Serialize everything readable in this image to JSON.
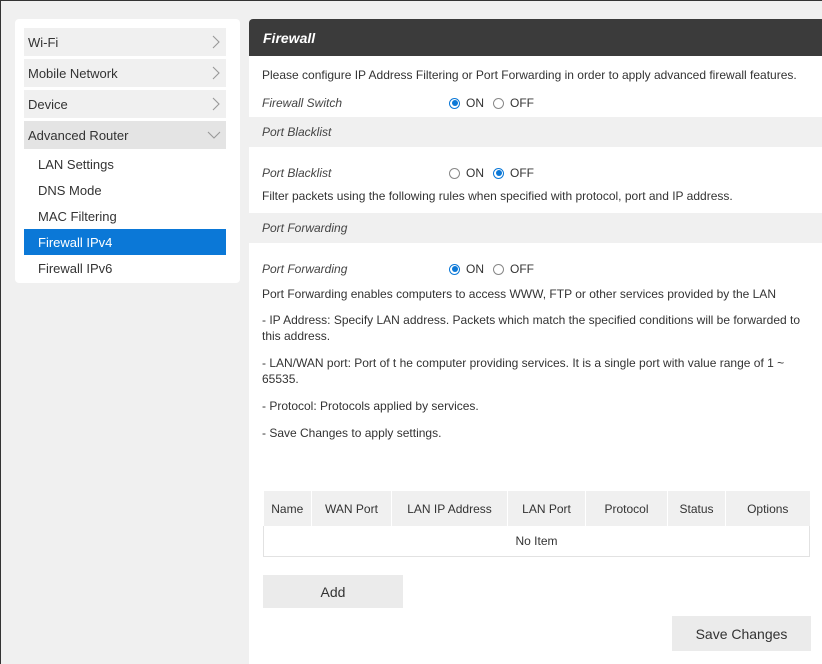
{
  "sidebar": {
    "menu": [
      {
        "label": "Wi-Fi"
      },
      {
        "label": "Mobile Network"
      },
      {
        "label": "Device"
      }
    ],
    "advanced": {
      "label": "Advanced Router",
      "items": [
        "LAN Settings",
        "DNS Mode",
        "MAC Filtering",
        "Firewall IPv4",
        "Firewall IPv6"
      ],
      "active": "Firewall IPv4"
    }
  },
  "main": {
    "title": "Firewall",
    "intro": "Please configure IP Address Filtering or Port Forwarding in order to apply advanced firewall features.",
    "firewall_switch": {
      "label": "Firewall Switch",
      "on": "ON",
      "off": "OFF",
      "value": "ON"
    },
    "blacklist_section": "Port Blacklist",
    "port_blacklist": {
      "label": "Port Blacklist",
      "on": "ON",
      "off": "OFF",
      "value": "OFF"
    },
    "blacklist_desc": "Filter packets using the following rules when specified with protocol, port and IP address.",
    "forwarding_section": "Port Forwarding",
    "port_forwarding": {
      "label": "Port Forwarding",
      "on": "ON",
      "off": "OFF",
      "value": "ON"
    },
    "forwarding_desc": "Port Forwarding enables computers to access WWW, FTP or other services provided by the LAN",
    "notes": [
      "- IP Address: Specify LAN address. Packets which match the specified conditions will be forwarded to this address.",
      "- LAN/WAN port: Port of t he computer providing services. It is a single port with value range of 1 ~ 65535.",
      "- Protocol: Protocols applied by services.",
      "- Save Changes to apply settings."
    ],
    "table": {
      "columns": [
        "Name",
        "WAN Port",
        "LAN IP Address",
        "LAN Port",
        "Protocol",
        "Status",
        "Options"
      ],
      "empty": "No Item"
    },
    "add_label": "Add",
    "save_label": "Save Changes"
  },
  "colors": {
    "accent": "#0b78d7",
    "header_bg": "#3b3b3b",
    "page_bg": "#f0f0f0"
  }
}
